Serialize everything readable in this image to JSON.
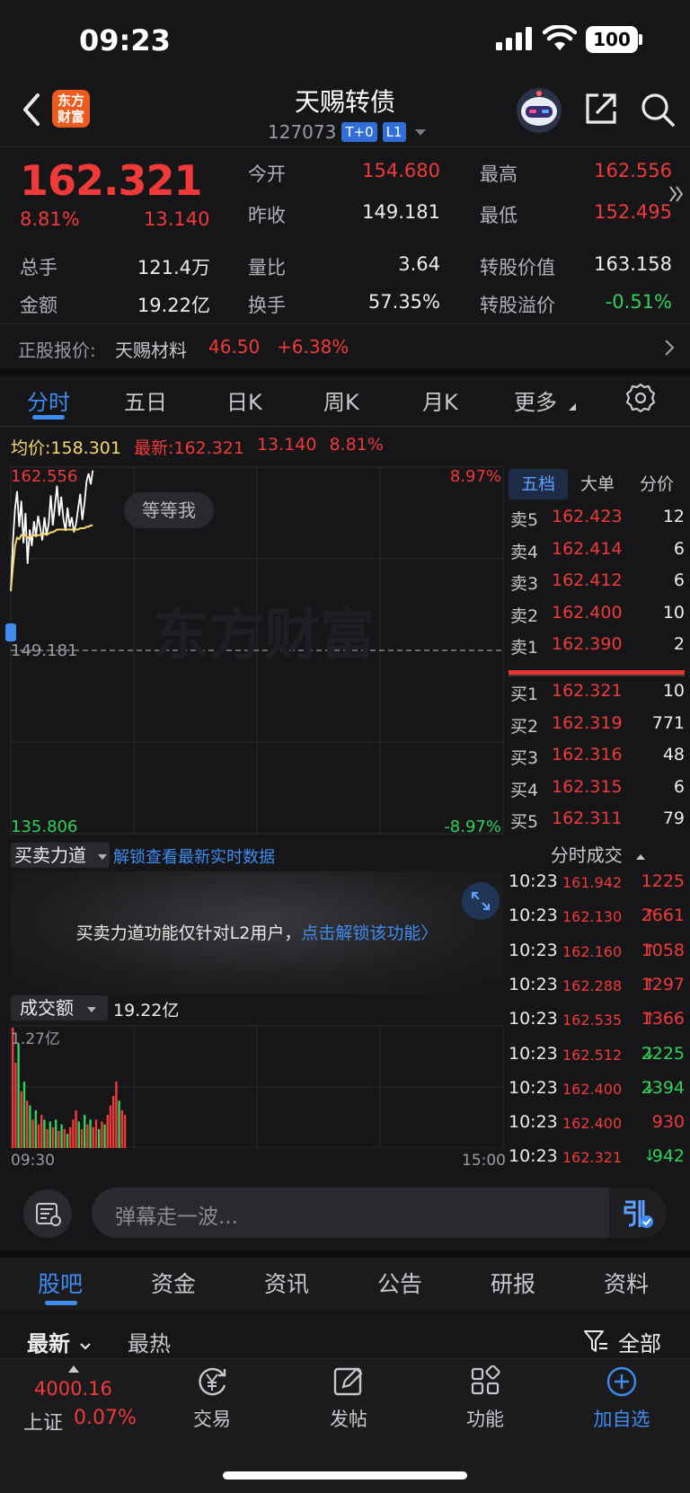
{
  "status": {
    "time": "09:23",
    "battery": "100"
  },
  "header": {
    "logo_line1": "东方",
    "logo_line2": "财富",
    "name": "天赐转债",
    "code": "127073",
    "tags": [
      "T+0",
      "L1"
    ]
  },
  "quote": {
    "price": "162.321",
    "pct": "8.81%",
    "change": "13.140",
    "fields": [
      {
        "label": "今开",
        "value": "154.680",
        "color": "red"
      },
      {
        "label": "最高",
        "value": "162.556",
        "color": "red"
      },
      {
        "label": "昨收",
        "value": "149.181",
        "color": "white"
      },
      {
        "label": "最低",
        "value": "152.495",
        "color": "red"
      },
      {
        "label": "总手",
        "value": "121.4万",
        "color": "white"
      },
      {
        "label": "量比",
        "value": "3.64",
        "color": "white"
      },
      {
        "label": "转股价值",
        "value": "163.158",
        "color": "white"
      },
      {
        "label": "金额",
        "value": "19.22亿",
        "color": "white"
      },
      {
        "label": "换手",
        "value": "57.35%",
        "color": "white"
      },
      {
        "label": "转股溢价",
        "value": "-0.51%",
        "color": "green"
      }
    ],
    "underlying_label": "正股报价:",
    "underlying_name": "天赐材料",
    "underlying_price": "46.50",
    "underlying_pct": "+6.38%"
  },
  "chart_tabs": [
    "分时",
    "五日",
    "日K",
    "周K",
    "月K",
    "更多"
  ],
  "chart_header": {
    "avg_label": "均价:",
    "avg_value": "158.301",
    "latest_label": "最新:",
    "latest_value": "162.321",
    "latest_change": "13.140",
    "latest_pct": "8.81%"
  },
  "chart_data": {
    "type": "line",
    "y_labels": {
      "top": "162.556",
      "mid": "149.181",
      "bottom": "135.806"
    },
    "pct_labels": {
      "top": "8.97%",
      "bottom": "-8.97%"
    },
    "ylim": [
      135.806,
      162.556
    ],
    "prev_close": 149.181,
    "series": [
      {
        "values": [
          153.5,
          157.0,
          159.5,
          160.8,
          158.2,
          160.1,
          157.0,
          159.2,
          155.5,
          158.0,
          156.8,
          158.6,
          157.5,
          159.0,
          158.1,
          157.2,
          158.9,
          157.6,
          158.4,
          160.5,
          158.3,
          159.8,
          161.2,
          159.0,
          160.4,
          158.8,
          157.9,
          159.6,
          158.2,
          158.9,
          157.8,
          158.4,
          159.5,
          160.6,
          158.7,
          159.9,
          161.5,
          162.1,
          161.3,
          162.321
        ]
      },
      {
        "values": [
          153.5,
          155.2,
          156.8,
          157.4,
          157.3,
          157.6,
          157.5,
          157.6,
          157.4,
          157.5,
          157.5,
          157.6,
          157.5,
          157.6,
          157.6,
          157.6,
          157.7,
          157.6,
          157.7,
          157.8,
          157.8,
          157.9,
          158.0,
          158.0,
          158.0,
          158.0,
          158.0,
          158.0,
          158.0,
          158.0,
          158.0,
          158.0,
          158.0,
          158.1,
          158.1,
          158.1,
          158.2,
          158.2,
          158.3,
          158.301
        ]
      }
    ],
    "volume": {
      "max_label": "1.27亿",
      "values": [
        1.27,
        0.9,
        1.1,
        0.6,
        0.7,
        0.5,
        0.45,
        0.3,
        0.4,
        0.25,
        0.35,
        0.3,
        0.2,
        0.28,
        0.22,
        0.3,
        0.18,
        0.25,
        0.2,
        0.15,
        0.22,
        0.3,
        0.4,
        0.28,
        0.2,
        0.35,
        0.25,
        0.3,
        0.22,
        0.3,
        0.2,
        0.28,
        0.25,
        0.35,
        0.45,
        0.55,
        0.7,
        0.5,
        0.4,
        0.35
      ],
      "colors": [
        "red",
        "red",
        "green",
        "red",
        "green",
        "red",
        "green",
        "red",
        "green",
        "red",
        "red",
        "green",
        "red",
        "green",
        "red",
        "green",
        "red",
        "green",
        "red",
        "green",
        "red",
        "red",
        "red",
        "green",
        "red",
        "green",
        "red",
        "green",
        "red",
        "red",
        "green",
        "red",
        "green",
        "red",
        "red",
        "red",
        "red",
        "green",
        "red",
        "red"
      ]
    },
    "x_labels": [
      "09:30",
      "15:00"
    ]
  },
  "watermark": "东方财富",
  "tooltip": "等等我",
  "book": {
    "tabs": [
      "五档",
      "大单",
      "分价"
    ],
    "asks": [
      {
        "label": "卖5",
        "price": "162.423",
        "qty": "12"
      },
      {
        "label": "卖4",
        "price": "162.414",
        "qty": "6"
      },
      {
        "label": "卖3",
        "price": "162.412",
        "qty": "6"
      },
      {
        "label": "卖2",
        "price": "162.400",
        "qty": "10"
      },
      {
        "label": "卖1",
        "price": "162.390",
        "qty": "2"
      }
    ],
    "bids": [
      {
        "label": "买1",
        "price": "162.321",
        "qty": "10"
      },
      {
        "label": "买2",
        "price": "162.319",
        "qty": "771"
      },
      {
        "label": "买3",
        "price": "162.316",
        "qty": "48"
      },
      {
        "label": "买4",
        "price": "162.315",
        "qty": "6"
      },
      {
        "label": "买5",
        "price": "162.311",
        "qty": "79"
      }
    ]
  },
  "trades": {
    "title": "分时成交",
    "rows": [
      {
        "time": "10:23",
        "price": "161.942",
        "arrow": "",
        "vol": "1225",
        "color": "red"
      },
      {
        "time": "10:23",
        "price": "162.130",
        "arrow": "↑",
        "vol": "2661",
        "color": "red"
      },
      {
        "time": "10:23",
        "price": "162.160",
        "arrow": "↑",
        "vol": "1058",
        "color": "red"
      },
      {
        "time": "10:23",
        "price": "162.288",
        "arrow": "↑",
        "vol": "1297",
        "color": "red"
      },
      {
        "time": "10:23",
        "price": "162.535",
        "arrow": "↑",
        "vol": "1366",
        "color": "red"
      },
      {
        "time": "10:23",
        "price": "162.512",
        "arrow": "↓",
        "vol": "2225",
        "color": "green"
      },
      {
        "time": "10:23",
        "price": "162.400",
        "arrow": "↓",
        "vol": "2394",
        "color": "green"
      },
      {
        "time": "10:23",
        "price": "162.400",
        "arrow": "",
        "vol": "930",
        "color": "red"
      },
      {
        "time": "10:23",
        "price": "162.321",
        "arrow": "↓",
        "vol": "942",
        "color": "green"
      }
    ]
  },
  "power": {
    "select": "买卖力道",
    "link": "解锁查看最新实时数据",
    "msg": "买卖力道功能仅针对L2用户，",
    "msg_link": "点击解锁该功能〉"
  },
  "volume_header": {
    "select": "成交额",
    "value": "19.22亿"
  },
  "danmu": {
    "placeholder": "弹幕走一波..."
  },
  "bottom_tabs": [
    "股吧",
    "资金",
    "资讯",
    "公告",
    "研报",
    "资料"
  ],
  "filters": {
    "latest": "最新",
    "hot": "最热",
    "all": "全部"
  },
  "nav": {
    "index_value": "4000.16",
    "index_name": "上证",
    "index_pct": "0.07%",
    "items": [
      "交易",
      "发帖",
      "功能",
      "加自选"
    ]
  }
}
